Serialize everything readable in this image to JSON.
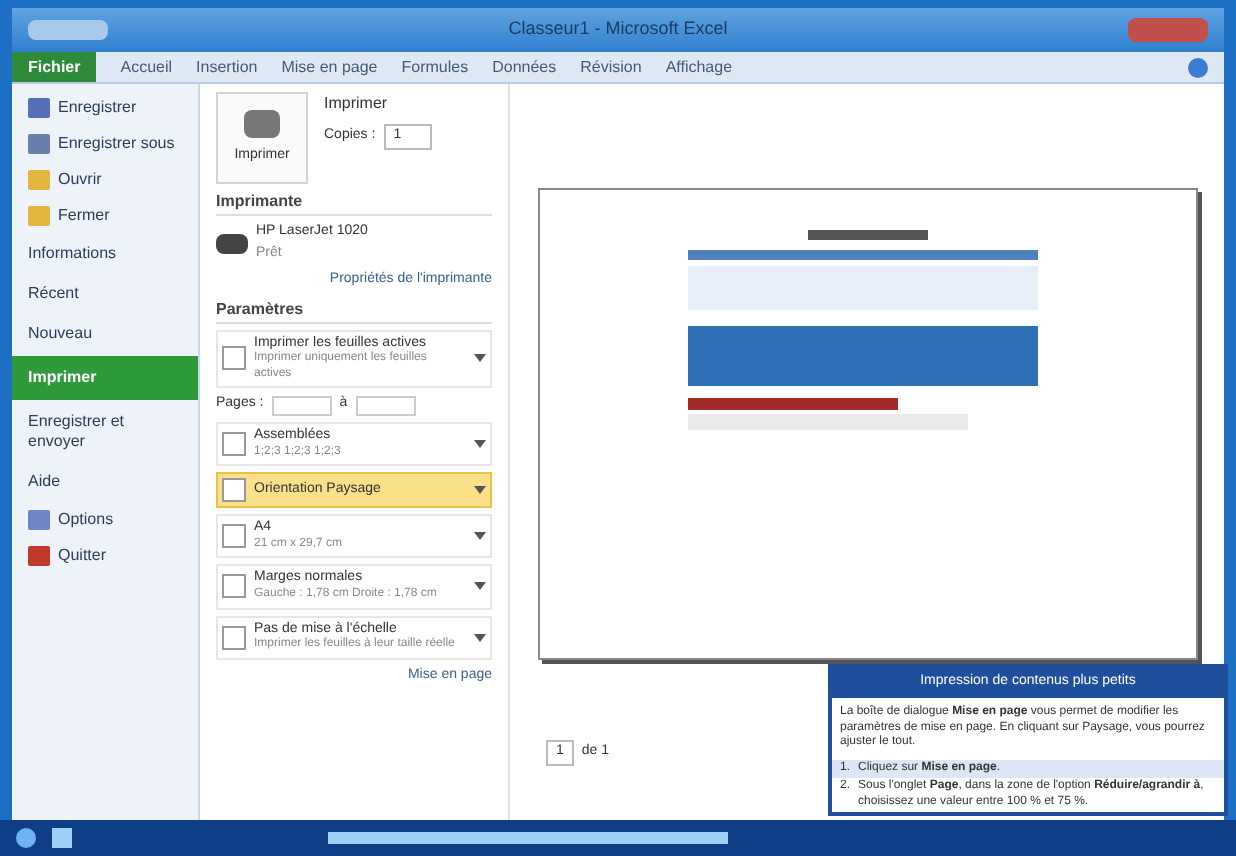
{
  "window": {
    "title": "Classeur1 - Microsoft Excel"
  },
  "ribbon_tabs": [
    {
      "label": "Fichier",
      "selected": true
    },
    {
      "label": "Accueil",
      "selected": false
    },
    {
      "label": "Insertion",
      "selected": false
    },
    {
      "label": "Mise en page",
      "selected": false
    },
    {
      "label": "Formules",
      "selected": false
    },
    {
      "label": "Données",
      "selected": false
    },
    {
      "label": "Révision",
      "selected": false
    },
    {
      "label": "Affichage",
      "selected": false
    }
  ],
  "sidebar": {
    "items": [
      {
        "label": "Enregistrer",
        "kind": "command",
        "selected": false
      },
      {
        "label": "Enregistrer sous",
        "kind": "command",
        "selected": false
      },
      {
        "label": "Ouvrir",
        "kind": "command",
        "selected": false
      },
      {
        "label": "Fermer",
        "kind": "command",
        "selected": false
      },
      {
        "label": "Informations",
        "kind": "section",
        "selected": false
      },
      {
        "label": "Récent",
        "kind": "section",
        "selected": false
      },
      {
        "label": "Nouveau",
        "kind": "section",
        "selected": false
      },
      {
        "label": "Imprimer",
        "kind": "section",
        "selected": true
      },
      {
        "label": "Enregistrer et envoyer",
        "kind": "section",
        "selected": false
      },
      {
        "label": "Aide",
        "kind": "section",
        "selected": false
      },
      {
        "label": "Options",
        "kind": "command",
        "selected": false
      },
      {
        "label": "Quitter",
        "kind": "command",
        "selected": false
      }
    ]
  },
  "print": {
    "button": "Imprimer",
    "copies_heading": "Imprimer",
    "copies_label": "Copies :",
    "copies_value": "1",
    "printer_heading": "Imprimante",
    "printer_name": "HP LaserJet 1020",
    "printer_status": "Prêt",
    "printer_properties": "Propriétés de l'imprimante",
    "settings_heading": "Paramètres",
    "settings": [
      {
        "title": "Imprimer les feuilles actives",
        "subtitle": "Imprimer uniquement les feuilles actives",
        "highlighted": false
      },
      {
        "kind": "pages",
        "label": "Pages :",
        "to": "à"
      },
      {
        "title": "Assemblées",
        "subtitle": "1;2;3   1;2;3   1;2;3",
        "highlighted": false
      },
      {
        "title": "Orientation Paysage",
        "highlighted": true
      },
      {
        "title": "A4",
        "subtitle": "21 cm x 29,7 cm",
        "highlighted": false
      },
      {
        "title": "Marges normales",
        "subtitle": "Gauche : 1,78 cm   Droite : 1,78 cm",
        "highlighted": false
      },
      {
        "title": "Pas de mise à l'échelle",
        "subtitle": "Imprimer les feuilles à leur taille réelle",
        "highlighted": false
      }
    ],
    "page_setup_link": "Mise en page"
  },
  "preview": {
    "pager": "1",
    "pager_of": "de 1"
  },
  "tip": {
    "title": "Impression de contenus plus petits",
    "body": "La boîte de dialogue **Mise en page** vous permet de modifier les paramètres de mise en page. En cliquant sur Paysage, vous pourrez ajuster le tout.",
    "steps": [
      {
        "number": "1.",
        "text": "Cliquez sur **Mise en page**.",
        "selected": true
      },
      {
        "number": "2.",
        "text": "Sous l'onglet **Page**, dans la zone de l'option **Réduire/agrandir à**, choisissez une valeur entre 100 % et 75 %.",
        "selected": false
      }
    ]
  }
}
